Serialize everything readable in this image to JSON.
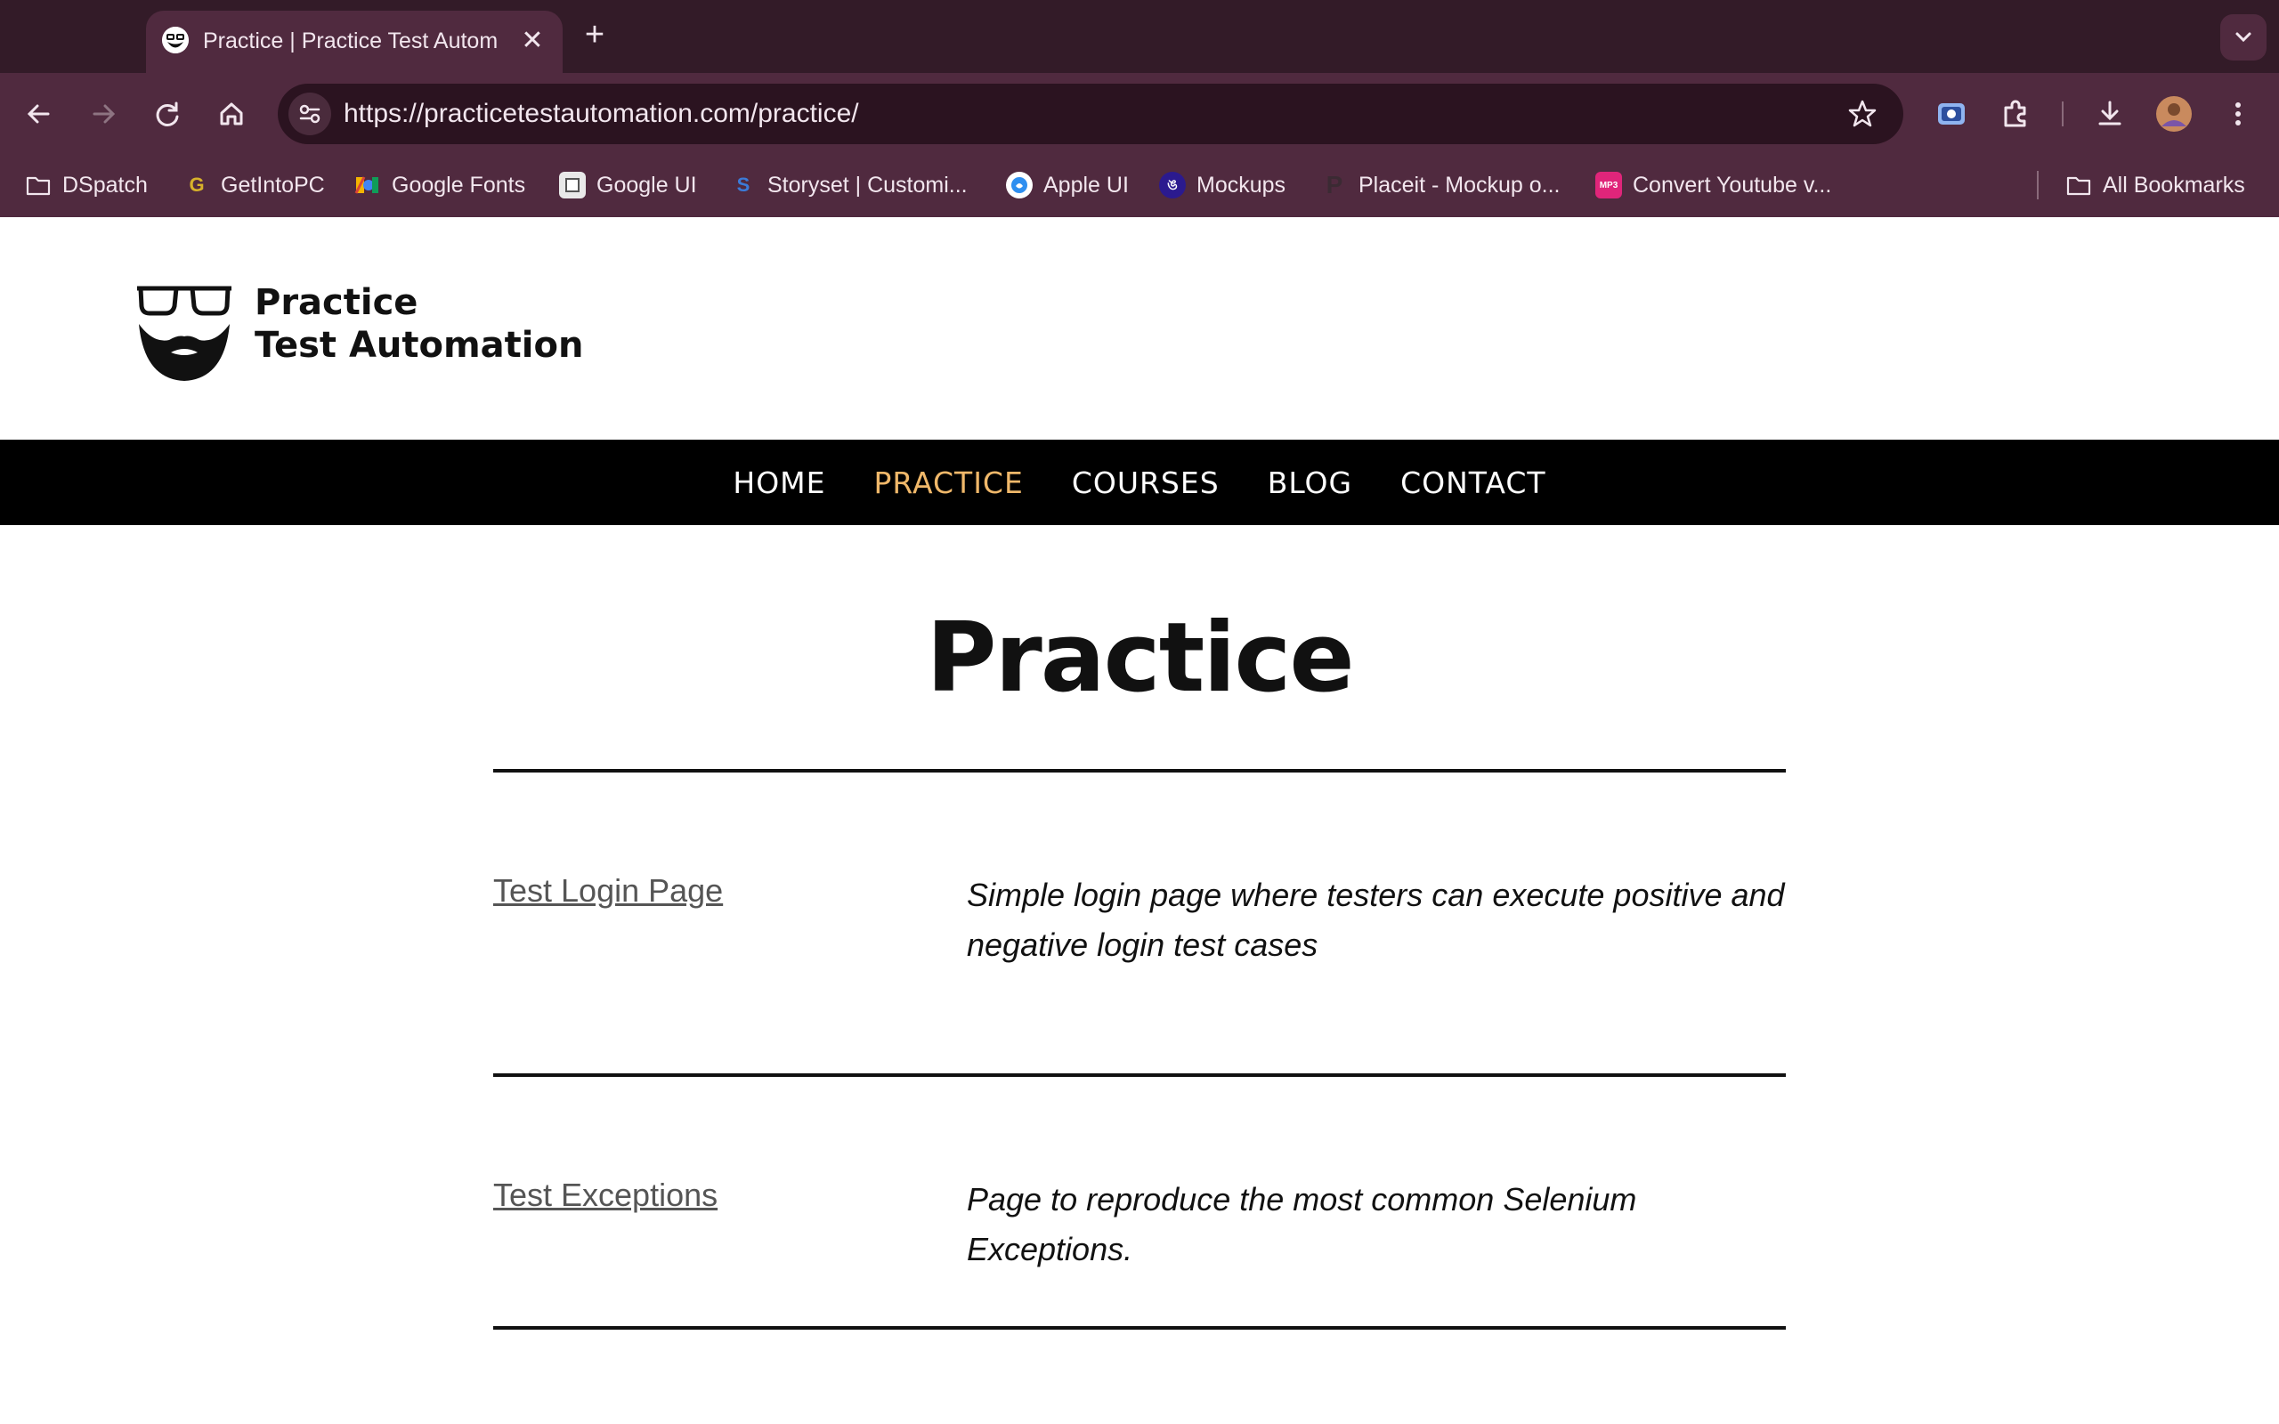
{
  "browser": {
    "tab": {
      "title": "Practice | Practice Test Automation",
      "favicon": "beard-logo-icon"
    },
    "new_tab_label": "+",
    "close_label": "✕",
    "url": "https://practicetestautomation.com/practice/",
    "bookmarks": [
      {
        "label": "DSpatch",
        "icon": "folder-icon"
      },
      {
        "label": "GetIntoPC",
        "icon": "getintopc-icon"
      },
      {
        "label": "Google Fonts",
        "icon": "google-fonts-icon"
      },
      {
        "label": "Google UI",
        "icon": "google-ui-icon"
      },
      {
        "label": "Storyset | Customi...",
        "icon": "storyset-icon"
      },
      {
        "label": "Apple UI",
        "icon": "apple-ui-icon"
      },
      {
        "label": "Mockups",
        "icon": "mockups-icon"
      },
      {
        "label": "Placeit - Mockup o...",
        "icon": "placeit-icon"
      },
      {
        "label": "Convert Youtube v...",
        "icon": "mp3-convert-icon"
      }
    ],
    "all_bookmarks": "All Bookmarks"
  },
  "site": {
    "logo_line1": "Practice",
    "logo_line2": "Test Automation",
    "nav": [
      {
        "label": "HOME",
        "active": false
      },
      {
        "label": "PRACTICE",
        "active": true
      },
      {
        "label": "COURSES",
        "active": false
      },
      {
        "label": "BLOG",
        "active": false
      },
      {
        "label": "CONTACT",
        "active": false
      }
    ],
    "nav_active_color": "#f0b86a"
  },
  "main": {
    "title": "Practice",
    "items": [
      {
        "link": "Test Login Page",
        "description": "Simple login page where testers can execute positive and negative login test cases"
      },
      {
        "link": "Test Exceptions",
        "description": "Page to reproduce the most common Selenium Exceptions."
      }
    ]
  }
}
